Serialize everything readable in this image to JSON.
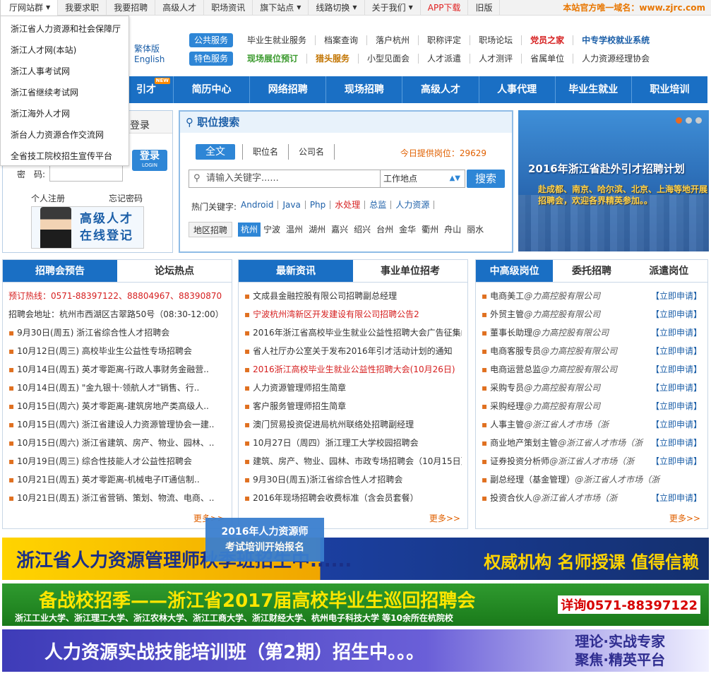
{
  "topbar": {
    "items": [
      {
        "label": "厅网站群",
        "caret": true
      },
      {
        "label": "我要求职",
        "caret": false
      },
      {
        "label": "我要招聘",
        "caret": false
      },
      {
        "label": "高级人才",
        "caret": false
      },
      {
        "label": "职场资讯",
        "caret": false
      },
      {
        "label": "旗下站点",
        "caret": true
      },
      {
        "label": "线路切换",
        "caret": true
      },
      {
        "label": "关于我们",
        "caret": true
      },
      {
        "label": "APP下载",
        "caret": false
      },
      {
        "label": "旧版",
        "caret": false
      }
    ],
    "domain_notice": "本站官方唯一域名：www.zjrc.com"
  },
  "dropdown": {
    "items": [
      "浙江省人力资源和社会保障厅",
      "浙江人才网(本站)",
      "浙江人事考试网",
      "浙江省继续考试网",
      "浙江海外人才网",
      "浙台人力资源合作交流网",
      "全省技工院校招生宣传平台"
    ]
  },
  "lang": {
    "traditional": "繁体版",
    "english": "English"
  },
  "services": {
    "public_tag": "公共服务",
    "public_links": [
      "毕业生就业服务",
      "档案查询",
      "落户杭州",
      "职称评定",
      "职场论坛",
      "党员之家",
      "中专学校就业系统"
    ],
    "special_tag": "特色服务",
    "special_links": [
      "现场展位预订",
      "猎头服务",
      "小型见面会",
      "人才派遣",
      "人才测评",
      "省属单位",
      "人力资源经理协会"
    ]
  },
  "nav": {
    "items": [
      "引才",
      "简历中心",
      "网络招聘",
      "现场招聘",
      "高级人才",
      "人事代理",
      "毕业生就业",
      "职业培训"
    ],
    "new_badge": "NEW"
  },
  "login": {
    "title": "登录",
    "button": "登录",
    "button_sub": "LOGIN",
    "password_label": "密　码:",
    "register": "个人注册",
    "forgot": "忘记密码",
    "ad_line1": "高级人才",
    "ad_line2": "在线登记"
  },
  "search": {
    "title": "职位搜索",
    "tabs": [
      "全文",
      "职位名",
      "公司名"
    ],
    "today_label": "今日提供岗位：29629",
    "keyword_placeholder": "请输入关键字......",
    "location": "工作地点",
    "button": "搜索",
    "hot_label": "热门关键字:",
    "hot_keywords": [
      "Android",
      "Java",
      "Php",
      "水处理",
      "总监",
      "人力资源"
    ],
    "area_button": "地区招聘",
    "areas": [
      "杭州",
      "宁波",
      "温州",
      "湖州",
      "嘉兴",
      "绍兴",
      "台州",
      "金华",
      "衢州",
      "舟山",
      "丽水"
    ]
  },
  "banner": {
    "title": "2016年浙江省赴外引才招聘计划",
    "subtitle": "赴成都、南京、哈尔滨、北京、上海等地开展招聘会，欢迎各界精英参加。。"
  },
  "panel1": {
    "tabs": [
      "招聘会预告",
      "论坛热点"
    ],
    "hotline": "预订热线：0571-88397122、88804967、88390870",
    "address": "招聘会地址：杭州市西湖区古翠路50号（08:30-12:00）",
    "items": [
      "9月30日(周五) 浙江省综合性人才招聘会",
      "10月12日(周三) 高校毕业生公益性专场招聘会",
      "10月14日(周五) 英才零距离-行政人事财务金融营..",
      "10月14日(周五) \"金九银十·领航人才\"销售、行..",
      "10月15日(周六) 英才零距离-建筑房地产类高级人..",
      "10月15日(周六) 浙江省建设人力资源管理协会一建..",
      "10月15日(周六) 浙江省建筑、房产、物业、园林、..",
      "10月19日(周三) 综合性技能人才公益性招聘会",
      "10月21日(周五) 英才零距离-机械电子IT通信制..",
      "10月21日(周五) 浙江省营销、策划、物流、电商、.."
    ],
    "more": "更多>>"
  },
  "panel2": {
    "tabs": [
      "最新资讯",
      "事业单位招考"
    ],
    "items": [
      {
        "text": "文成县金融控股有限公司招聘副总经理",
        "red": false
      },
      {
        "text": "宁波杭州湾新区开发建设有限公司招聘公告2",
        "red": true
      },
      {
        "text": "2016年浙江省高校毕业生就业公益性招聘大会广告征集函",
        "red": false
      },
      {
        "text": "省人社厅办公室关于发布2016年引才活动计划的通知",
        "red": false
      },
      {
        "text": "2016浙江高校毕业生就业公益性招聘大会(10月26日)",
        "red": true
      },
      {
        "text": "人力资源管理师招生简章",
        "red": false
      },
      {
        "text": "客户服务管理师招生简章",
        "red": false
      },
      {
        "text": "澳门贸易投资促进局杭州联络处招聘副经理",
        "red": false
      },
      {
        "text": "10月27日（周四）浙江理工大学校园招聘会",
        "red": false
      },
      {
        "text": "建筑、房产、物业、园林、市政专场招聘会（10月15日）",
        "red": false
      },
      {
        "text": "9月30日(周五)浙江省综合性人才招聘会",
        "red": false
      },
      {
        "text": "2016年现场招聘会收费标准（含会员套餐）",
        "red": false
      }
    ],
    "more": "更多>>"
  },
  "panel3": {
    "tabs": [
      "中高级岗位",
      "委托招聘",
      "派遣岗位"
    ],
    "apply": "【立即申请】",
    "items": [
      {
        "job": "电商美工",
        "company": "@力高控股有限公司"
      },
      {
        "job": "外贸主管",
        "company": "@力高控股有限公司"
      },
      {
        "job": "董事长助理",
        "company": "@力高控股有限公司"
      },
      {
        "job": "电商客服专员",
        "company": "@力高控股有限公司"
      },
      {
        "job": "电商运营总监",
        "company": "@力高控股有限公司"
      },
      {
        "job": "采购专员",
        "company": "@力高控股有限公司"
      },
      {
        "job": "采购经理",
        "company": "@力高控股有限公司"
      },
      {
        "job": "人事主管",
        "company": "@浙江省人才市场（浙"
      },
      {
        "job": "商业地产策划主管",
        "company": "@浙江省人才市场（浙"
      },
      {
        "job": "证券投资分析师",
        "company": "@浙江省人才市场（浙"
      },
      {
        "job": "副总经理（基金管理）",
        "company": "@浙江省人才市场（浙"
      },
      {
        "job": "投资合伙人",
        "company": "@浙江省人才市场（浙"
      }
    ],
    "more": "更多>>"
  },
  "overlay_ad": {
    "line1": "2016年人力资源师",
    "line2": "考试培训开始报名"
  },
  "bottom_banners": {
    "b1_left": "浙江省人力资源管理师秋季班招生中......",
    "b1_right": "权威机构 名师授课 值得信赖",
    "b2_title": "备战校招季——浙江省2017届高校毕业生巡回招聘会",
    "b2_schools": "浙江工业大学、浙江理工大学、浙江农林大学、浙江工商大学、浙江财经大学、杭州电子科技大学 等10余所在杭院校",
    "b2_phone": "详询0571-88397122",
    "b3_left": "人力资源实战技能培训班（第2期）招生中。。。",
    "b3_right1": "理论·实战专家",
    "b3_right2": "聚焦·精英平台"
  }
}
